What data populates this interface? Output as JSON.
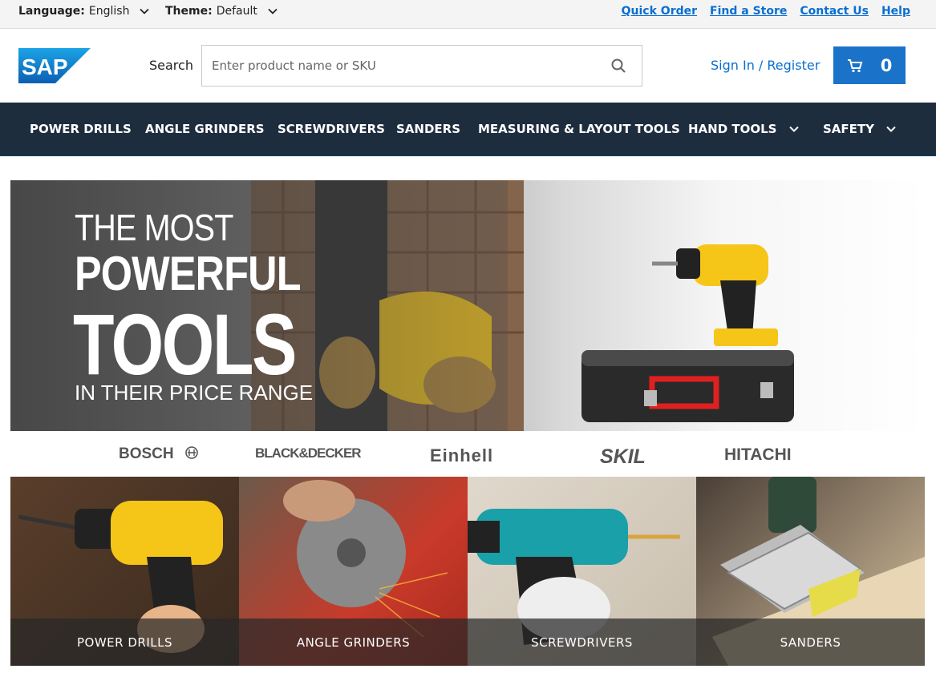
{
  "topbar": {
    "language_label": "Language:",
    "language_value": "English",
    "theme_label": "Theme:",
    "theme_value": "Default",
    "links": [
      "Quick Order",
      "Find a Store",
      "Contact Us",
      "Help"
    ]
  },
  "header": {
    "logo_text": "SAP",
    "search_label": "Search",
    "search_placeholder": "Enter product name or SKU",
    "signin": "Sign In / Register",
    "cart_count": "0"
  },
  "nav": {
    "items": [
      "POWER DRILLS",
      "ANGLE GRINDERS",
      "SCREWDRIVERS",
      "SANDERS",
      "MEASURING & LAYOUT TOOLS",
      "HAND TOOLS",
      "SAFETY"
    ]
  },
  "hero": {
    "line1": "THE MOST",
    "line2": "POWERFUL",
    "line3": "TOOLS",
    "line4": "IN THEIR PRICE RANGE"
  },
  "brands": [
    "BOSCH",
    "BLACK&DECKER",
    "Einhell",
    "SKIL",
    "HITACHI"
  ],
  "categories": [
    "POWER DRILLS",
    "ANGLE GRINDERS",
    "SCREWDRIVERS",
    "SANDERS"
  ],
  "colors": {
    "accent": "#0a6ed1",
    "nav_bg": "#1d2d3e",
    "cart_bg": "#1a73c8",
    "drill_yellow": "#f5c518"
  }
}
